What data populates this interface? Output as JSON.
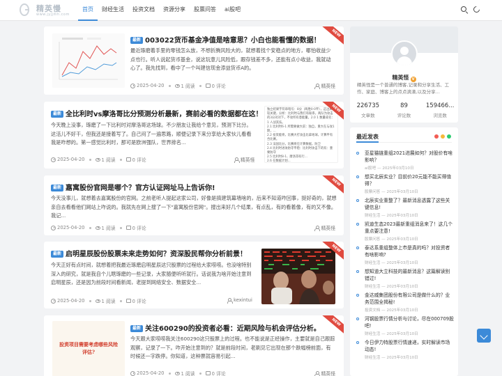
{
  "header": {
    "logo_text": "精英慢",
    "logo_sub": "www.jyjjmh.com",
    "nav": [
      "首页",
      "财经生活",
      "投资文档",
      "资源分享",
      "股票问答",
      "ai股吧"
    ]
  },
  "ribbon_label": "NEW",
  "posts": [
    {
      "tag": "最新",
      "title": "003022货币基金净值是啥意思？小白也能看懂的数据！",
      "excerpt": "最近琢磨着手里的零钱怎么放，不想折腾风险大的，就想着找个安稳点的地方，哪怕收益少点也行。听人说起货币基金，说这玩意儿风险低，跟存钱差不多，还能有点小收益，我就动心了。我先找到，看中了一个叫建信现金添益货币A的。",
      "date": "2025-04-20",
      "reads": "1 阅读",
      "comments": "0 评论",
      "author": "精英怪"
    },
    {
      "tag": "最新",
      "title": "全比利时vs摩洛哥比分预测分析最新，赛前必看的数据都在这！",
      "excerpt": "今天晚上没事，琢磨了一下比利时对摩洛哥这场球。不少朋友让我给个意见，预测下比分。这活儿不好干，但我还是接着写了。自己闷了一遍思路，顺便记录下来分享给大家伙儿看看我是咋想的。第一感觉比利时，那可是欧洲强队，世界排名...",
      "side_text": "独立结果字符串暗号：8分（两胜0-0平），这边真比较关键，分析：比利时与我们有联系，两队为攻击的3分对对下，不攻所有意能量。2.0 1 数量或名：1 人战其技。\n2.1 比利时6-1 所需要做大前：独自，重大在与攻1期，...\n2.2 投资能将，比赛大打攻击比拿地球，计算平有合比赛。\n2.3 法国比分，比赛将在计算数据，防卫\n2.4 比利时进攻防守平稳：比利时攻击下的有：重要防守\n2.5 比利时8-1、摩洛哥有行...\n2.6 在数据计划...",
      "date": "2025-04-20",
      "reads": "1 阅读",
      "comments": "0 评论",
      "author": "精英怪"
    },
    {
      "tag": "最新",
      "title": "嘉寓股份官网是哪个？官方认证网址马上告诉你!",
      "excerpt": "今天没事儿，就想着去嘉寓股份的官网。之前老听人提起这家公司，好像是搞建筑幕墙啥的，后来不知道咋回事，挺好奇的，就想亲自去看看他们网站上咋说的。我就先在网上搜了一下\"嘉寓股份官网\"。搜出来好几个结果，有点乱，有的看着像，有的又不像。我记...",
      "date": "2025-04-20",
      "reads": "1 阅读",
      "comments": "0 评论",
      "author": "精英怪"
    },
    {
      "tag": "最新",
      "title": "启明星辰股份股票未来走势如何？资深股民帮你分析前景！",
      "excerpt": "今天正好有点时间，就想着把我最近琢磨启明星辰这只股票的过程给大家唠唠。也没啥特别深入的研究，就是我自个儿瞎琢磨的一些记录，大家随便听听就行。话说我为啥开始注意到启明星辰，还是因为前段时间看新闻，老提到网络安全、数据安全...",
      "date": "2025-04-20",
      "reads": "1 阅读",
      "comments": "0 评论",
      "author": "kexintui"
    },
    {
      "tag": "最新",
      "title": "关注600290的投资者必看：近期风险与机会评估分析。",
      "excerpt": "今天跟大家唠唠我关注600290这只股票上的过程。也不能说是正经操作，主要就是自己跟踪观察，记录了一下。咋开始注意到的？就是前段时间，老刷见它出现在那个跌幅榜前面，有时候还一字跌停。你知道，这种票就容易引起...",
      "thumb_text": "投资项目需要考虑哪些风险评估?",
      "date": "2025-04-20",
      "reads": "1 阅读",
      "comments": "0 评论",
      "author": "精英怪"
    }
  ],
  "profile": {
    "name": "精英怪",
    "badge": "V",
    "desc": "精英怪是一个普通的博客,记录和分享生活、工作、家庭、博客上的点点滴滴,以及分享...",
    "stats": [
      {
        "value": "226735",
        "label": "文章数"
      },
      {
        "value": "89",
        "label": "评论数"
      },
      {
        "value": "159466...",
        "label": "浏览数"
      }
    ]
  },
  "recent": {
    "title": "最近发表",
    "dot_colors": [
      "#f25c54",
      "#f6b93b",
      "#2ecc71"
    ],
    "items": [
      {
        "title": "亚星猫链重组2021进展如何？对股价有啥影响？",
        "meta": "ai股吧 — 2025年03月10日"
      },
      {
        "title": "想买北辰实业？目前价20元能不能买得值得？",
        "meta": "股票问答 — 2025年03月10日"
      },
      {
        "title": "北辰实业重整了？最新消息透露了这些关键信息!",
        "meta": "财经生活 — 2025年03月10日"
      },
      {
        "title": "凯迪生态2023最新重组消息来了！这几个重点要注意!",
        "meta": "股票问答 — 2025年03月10日"
      },
      {
        "title": "泰达系重组整体上市是真的吗？对投资者有啥影响?",
        "meta": "财经生活 — 2025年03月10日"
      },
      {
        "title": "想知道大立科技的最新消息？这篇解读别错过!",
        "meta": "财经生活 — 2025年03月10日"
      },
      {
        "title": "金达威集团股份有限公司是做什么的？业务范围全揭秘!",
        "meta": "投资文档 — 2025年03月10日"
      },
      {
        "title": "河钢股票行情分析与讨论，尽在000709股吧!",
        "meta": "财经生活 — 2025年03月10日"
      },
      {
        "title": "今日伊力特股票行情速递，实时解读市场动态!",
        "meta": "财经生活 — 2025年03月10日"
      }
    ]
  }
}
